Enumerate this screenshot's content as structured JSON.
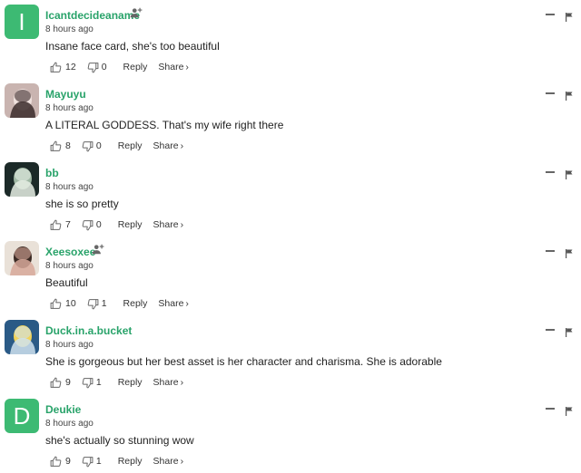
{
  "comments": [
    {
      "username": "Icantdecideaname",
      "avatar_letter": "I",
      "avatar_type": "letter",
      "verified_follow": true,
      "time": "8 hours ago",
      "text": "Insane face card, she's too beautiful",
      "upvotes": "12",
      "downvotes": "0",
      "reply_label": "Reply",
      "share_label": "Share",
      "share_chevron": "›"
    },
    {
      "username": "Mayuyu",
      "avatar_type": "photo",
      "avatar_colors": [
        "#c9b4b0",
        "#f0e2de",
        "#3a2a2a"
      ],
      "verified_follow": false,
      "time": "8 hours ago",
      "text": "A LITERAL GODDESS. That's my wife right there",
      "upvotes": "8",
      "downvotes": "0",
      "reply_label": "Reply",
      "share_label": "Share",
      "share_chevron": "›"
    },
    {
      "username": "bb",
      "avatar_type": "photo",
      "avatar_colors": [
        "#1c2a28",
        "#9fb7a3",
        "#e6efe4"
      ],
      "verified_follow": false,
      "time": "8 hours ago",
      "text": "she is so pretty",
      "upvotes": "7",
      "downvotes": "0",
      "reply_label": "Reply",
      "share_label": "Share",
      "share_chevron": "›"
    },
    {
      "username": "Xeesoxee",
      "avatar_type": "photo",
      "avatar_colors": [
        "#e9e1d8",
        "#3b2a24",
        "#d7a89a"
      ],
      "verified_follow": true,
      "time": "8 hours ago",
      "text": "Beautiful",
      "upvotes": "10",
      "downvotes": "1",
      "reply_label": "Reply",
      "share_label": "Share",
      "share_chevron": "›"
    },
    {
      "username": "Duck.in.a.bucket",
      "avatar_type": "photo",
      "avatar_colors": [
        "#2a5a86",
        "#f1d35a",
        "#cfe2ef"
      ],
      "verified_follow": false,
      "time": "8 hours ago",
      "text": "She is gorgeous but her best asset is her character and charisma. She is adorable",
      "upvotes": "9",
      "downvotes": "1",
      "reply_label": "Reply",
      "share_label": "Share",
      "share_chevron": "›"
    },
    {
      "username": "Deukie",
      "avatar_letter": "D",
      "avatar_type": "letter",
      "verified_follow": false,
      "time": "8 hours ago",
      "text": "she's actually so stunning wow",
      "upvotes": "9",
      "downvotes": "1",
      "reply_label": "Reply",
      "share_label": "Share",
      "share_chevron": "›"
    }
  ],
  "colors": {
    "username": "#29a36a",
    "avatar_letter_bg": "#3dba73",
    "icon": "#666666"
  },
  "icons": {
    "upvote": "thumbs-up-icon",
    "downvote": "thumbs-down-icon",
    "follow": "add-user-icon",
    "minimize": "minimize-icon",
    "flag": "flag-icon"
  }
}
